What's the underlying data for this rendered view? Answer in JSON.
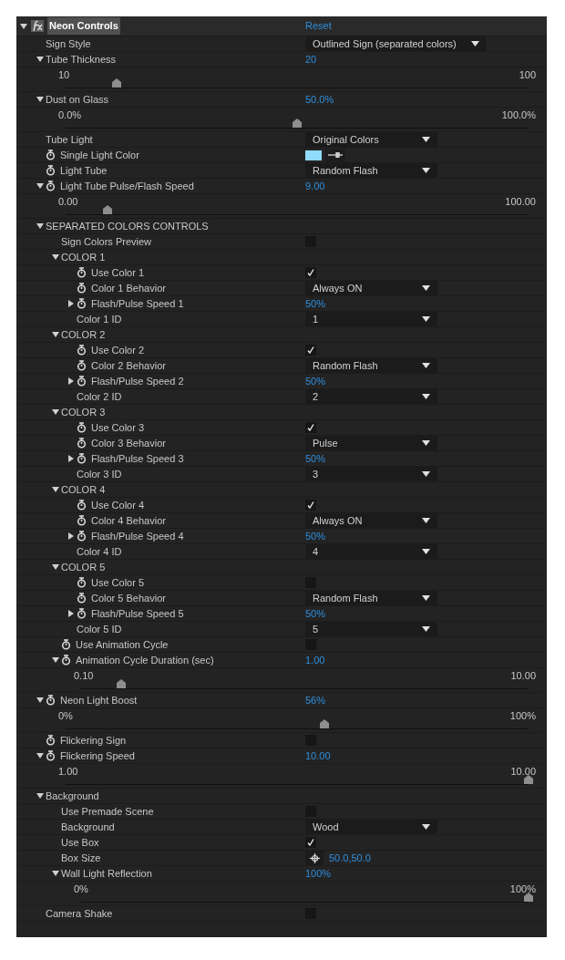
{
  "effect": {
    "name": "Neon Controls",
    "expanded": true,
    "reset": "Reset",
    "params": [
      {
        "kind": "popup",
        "label": "Sign Style",
        "animatable": false,
        "value": "Outlined Sign (separated colors)"
      },
      {
        "kind": "slider",
        "label": "Tube Thickness",
        "animatable": false,
        "expanded": true,
        "value": "20",
        "min": "10",
        "max": "100",
        "level": 0.11
      },
      {
        "kind": "slider",
        "label": "Dust on Glass",
        "animatable": false,
        "expanded": true,
        "value": "50.0%",
        "min": "0.0%",
        "max": "100.0%",
        "level": 0.5
      },
      {
        "kind": "popup",
        "label": "Tube Light",
        "animatable": false,
        "value": "Original Colors"
      },
      {
        "kind": "color",
        "label": "Single Light Color",
        "animatable": true,
        "color": "#8fdcff"
      },
      {
        "kind": "popup",
        "label": "Light Tube",
        "animatable": true,
        "value": "Random Flash"
      },
      {
        "kind": "slider",
        "label": "Light Tube Pulse/Flash Speed",
        "animatable": true,
        "expanded": true,
        "value": "9.00",
        "min": "0.00",
        "max": "100.00",
        "level": 0.09
      },
      {
        "kind": "group",
        "label": "SEPARATED COLORS CONTROLS",
        "expanded": true,
        "children": [
          {
            "kind": "checkbox",
            "label": "Sign Colors Preview",
            "animatable": false,
            "checked": false
          },
          {
            "kind": "group",
            "label": "COLOR 1",
            "expanded": true,
            "children": [
              {
                "kind": "checkbox",
                "label": "Use Color 1",
                "animatable": true,
                "checked": true
              },
              {
                "kind": "popup",
                "label": "Color 1 Behavior",
                "animatable": true,
                "value": "Always ON"
              },
              {
                "kind": "number",
                "label": "Flash/Pulse Speed 1",
                "animatable": true,
                "expanded": false,
                "value": "50%"
              },
              {
                "kind": "popup",
                "label": "Color 1 ID",
                "animatable": false,
                "value": "1"
              }
            ]
          },
          {
            "kind": "group",
            "label": "COLOR 2",
            "expanded": true,
            "children": [
              {
                "kind": "checkbox",
                "label": "Use Color 2",
                "animatable": true,
                "checked": true
              },
              {
                "kind": "popup",
                "label": "Color 2 Behavior",
                "animatable": true,
                "value": "Random Flash"
              },
              {
                "kind": "number",
                "label": "Flash/Pulse Speed 2",
                "animatable": true,
                "expanded": false,
                "value": "50%"
              },
              {
                "kind": "popup",
                "label": "Color 2 ID",
                "animatable": false,
                "value": "2"
              }
            ]
          },
          {
            "kind": "group",
            "label": "COLOR 3",
            "expanded": true,
            "children": [
              {
                "kind": "checkbox",
                "label": "Use Color 3",
                "animatable": true,
                "checked": true
              },
              {
                "kind": "popup",
                "label": "Color 3 Behavior",
                "animatable": true,
                "value": "Pulse"
              },
              {
                "kind": "number",
                "label": "Flash/Pulse Speed 3",
                "animatable": true,
                "expanded": false,
                "value": "50%"
              },
              {
                "kind": "popup",
                "label": "Color 3 ID",
                "animatable": false,
                "value": "3"
              }
            ]
          },
          {
            "kind": "group",
            "label": "COLOR 4",
            "expanded": true,
            "children": [
              {
                "kind": "checkbox",
                "label": "Use Color 4",
                "animatable": true,
                "checked": true
              },
              {
                "kind": "popup",
                "label": "Color 4 Behavior",
                "animatable": true,
                "value": "Always ON"
              },
              {
                "kind": "number",
                "label": "Flash/Pulse Speed 4",
                "animatable": true,
                "expanded": false,
                "value": "50%"
              },
              {
                "kind": "popup",
                "label": "Color 4 ID",
                "animatable": false,
                "value": "4"
              }
            ]
          },
          {
            "kind": "group",
            "label": "COLOR 5",
            "expanded": true,
            "children": [
              {
                "kind": "checkbox",
                "label": "Use Color 5",
                "animatable": true,
                "checked": false
              },
              {
                "kind": "popup",
                "label": "Color 5 Behavior",
                "animatable": true,
                "value": "Random Flash"
              },
              {
                "kind": "number",
                "label": "Flash/Pulse Speed 5",
                "animatable": true,
                "expanded": false,
                "value": "50%"
              },
              {
                "kind": "popup",
                "label": "Color 5 ID",
                "animatable": false,
                "value": "5"
              }
            ]
          },
          {
            "kind": "checkbox",
            "label": "Use Animation Cycle",
            "animatable": true,
            "checked": false
          },
          {
            "kind": "slider",
            "label": "Animation Cycle Duration (sec)",
            "animatable": true,
            "expanded": true,
            "value": "1.00",
            "min": "0.10",
            "max": "10.00",
            "level": 0.09
          }
        ]
      },
      {
        "kind": "slider",
        "label": "Neon Light Boost",
        "animatable": true,
        "expanded": true,
        "value": "56%",
        "min": "0%",
        "max": "100%",
        "level": 0.56
      },
      {
        "kind": "checkbox",
        "label": "Flickering Sign",
        "animatable": true,
        "checked": false
      },
      {
        "kind": "slider",
        "label": "Flickering Speed",
        "animatable": true,
        "expanded": true,
        "value": "10.00",
        "min": "1.00",
        "max": "10.00",
        "level": 1.0
      },
      {
        "kind": "group",
        "label": "Background",
        "expanded": true,
        "children": [
          {
            "kind": "checkbox",
            "label": "Use Premade Scene",
            "animatable": false,
            "checked": false
          },
          {
            "kind": "popup",
            "label": "Background",
            "animatable": false,
            "value": "Wood"
          },
          {
            "kind": "checkbox",
            "label": "Use Box",
            "animatable": false,
            "checked": true
          },
          {
            "kind": "point",
            "label": "Box Size",
            "animatable": false,
            "value": "50.0,50.0"
          },
          {
            "kind": "slider",
            "label": "Wall Light Reflection",
            "animatable": false,
            "expanded": true,
            "value": "100%",
            "min": "0%",
            "max": "100%",
            "level": 1.0
          }
        ]
      },
      {
        "kind": "checkbox",
        "label": "Camera Shake",
        "animatable": false,
        "checked": false
      }
    ]
  }
}
